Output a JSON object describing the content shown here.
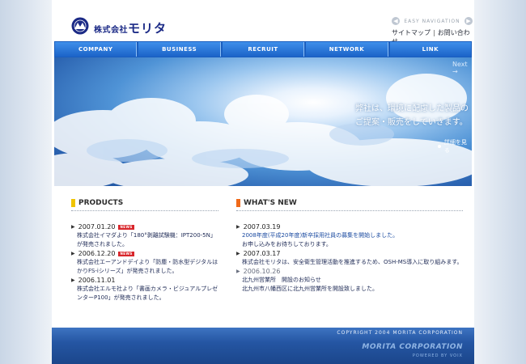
{
  "header": {
    "logo_icon": "morita-mark-icon",
    "company_prefix": "株式会社",
    "company_name": "モリタ",
    "easy_nav_label": "EASY NAVIGATION",
    "sitemap": "サイトマップ",
    "separator": "|",
    "contact": "お問い合わせ"
  },
  "nav": [
    "COMPANY",
    "BUSINESS",
    "RECRUIT",
    "NETWORK",
    "LINK"
  ],
  "hero": {
    "next": "Next →",
    "line1": "弊社は、環境に配慮した製品の",
    "line2": "ご提案・販売をしていきます。",
    "more": "詳細を見る"
  },
  "products": {
    "title": "PRODUCTS",
    "accent": "#f0c400",
    "items": [
      {
        "date": "2007.01.20",
        "badge": "NEWS",
        "text": "株式会社イマダより「180°剥離試験機：IPT200-5N」が発売されました。"
      },
      {
        "date": "2006.12.20",
        "badge": "NEWS",
        "text": "株式会社エーアンドデイより「防塵・防水型デジタルはかりFS-iシリーズ」が発売されました。"
      },
      {
        "date": "2006.11.01",
        "badge": "",
        "text": "株式会社エルモ社より「書画カメラ・ビジュアルプレゼンターP100」が発売されました。"
      }
    ]
  },
  "news": {
    "title": "WHAT'S NEW",
    "accent": "#f06a1a",
    "items": [
      {
        "date": "2007.03.19",
        "lines": [
          "2008年度(平成20年度)新卒採用社員の募集を開始しました。",
          "お申し込みをお待ちしております。"
        ]
      },
      {
        "date": "2007.03.17",
        "lines": [
          "株式会社モリタは、安全衛生管理活動を推進するため、OSH-MS導入に取り組みます。"
        ]
      },
      {
        "date": "2006.10.26",
        "lines": [
          "北九州営業所　開設のお知らせ",
          "北九州市八幡西区に北九州営業所を開設致しました。"
        ]
      }
    ]
  },
  "footer": {
    "copyright": "COPYRIGHT 2004 MORITA CORPORATION",
    "brand": "MORITA CORPORATION",
    "powered": "POWERED BY VOIX"
  }
}
